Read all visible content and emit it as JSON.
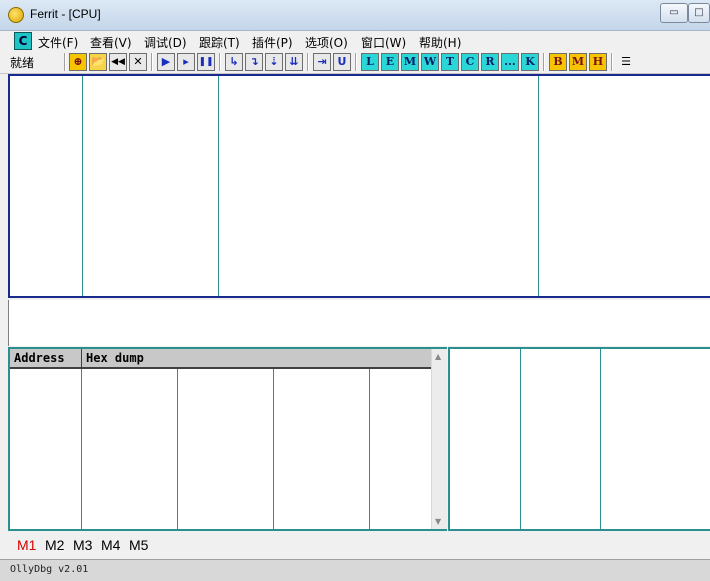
{
  "window": {
    "title": "Ferrit - [CPU]",
    "minimize_glyph": "▭",
    "maximize_glyph": "□"
  },
  "menu": {
    "system_label": "C",
    "items": [
      "文件(F)",
      "查看(V)",
      "调试(D)",
      "跟踪(T)",
      "插件(P)",
      "选项(O)",
      "窗口(W)",
      "帮助(H)"
    ]
  },
  "toolbar": {
    "status": "就绪",
    "buttons": {
      "attach": "⊕",
      "open": "📂",
      "restart": "◀◀",
      "close": "✕",
      "run": "▶",
      "run_thread": "▸",
      "pause": "❚❚",
      "step_into": "↳",
      "step_over": "↴",
      "trace_into": "⇣",
      "trace_over": "⇊",
      "execute_till_return": "⇥",
      "user_code": "U"
    },
    "window_letters": [
      "L",
      "E",
      "M",
      "W",
      "T",
      "C",
      "R",
      "...",
      "K"
    ],
    "bp_letters": [
      "B",
      "M",
      "H"
    ],
    "list_icon": "☰"
  },
  "dump": {
    "col_address": "Address",
    "col_hexdump": "Hex dump"
  },
  "memory_tabs": [
    "M1",
    "M2",
    "M3",
    "M4",
    "M5"
  ],
  "status_bar": {
    "text": "OllyDbg v2.01"
  },
  "colors": {
    "accent_cyan": "#2ad6d6",
    "accent_yellow": "#f6c400",
    "pane_border_blue": "#1a2a8a",
    "pane_border_teal": "#2b8f8f",
    "active_tab_red": "#d40000"
  }
}
